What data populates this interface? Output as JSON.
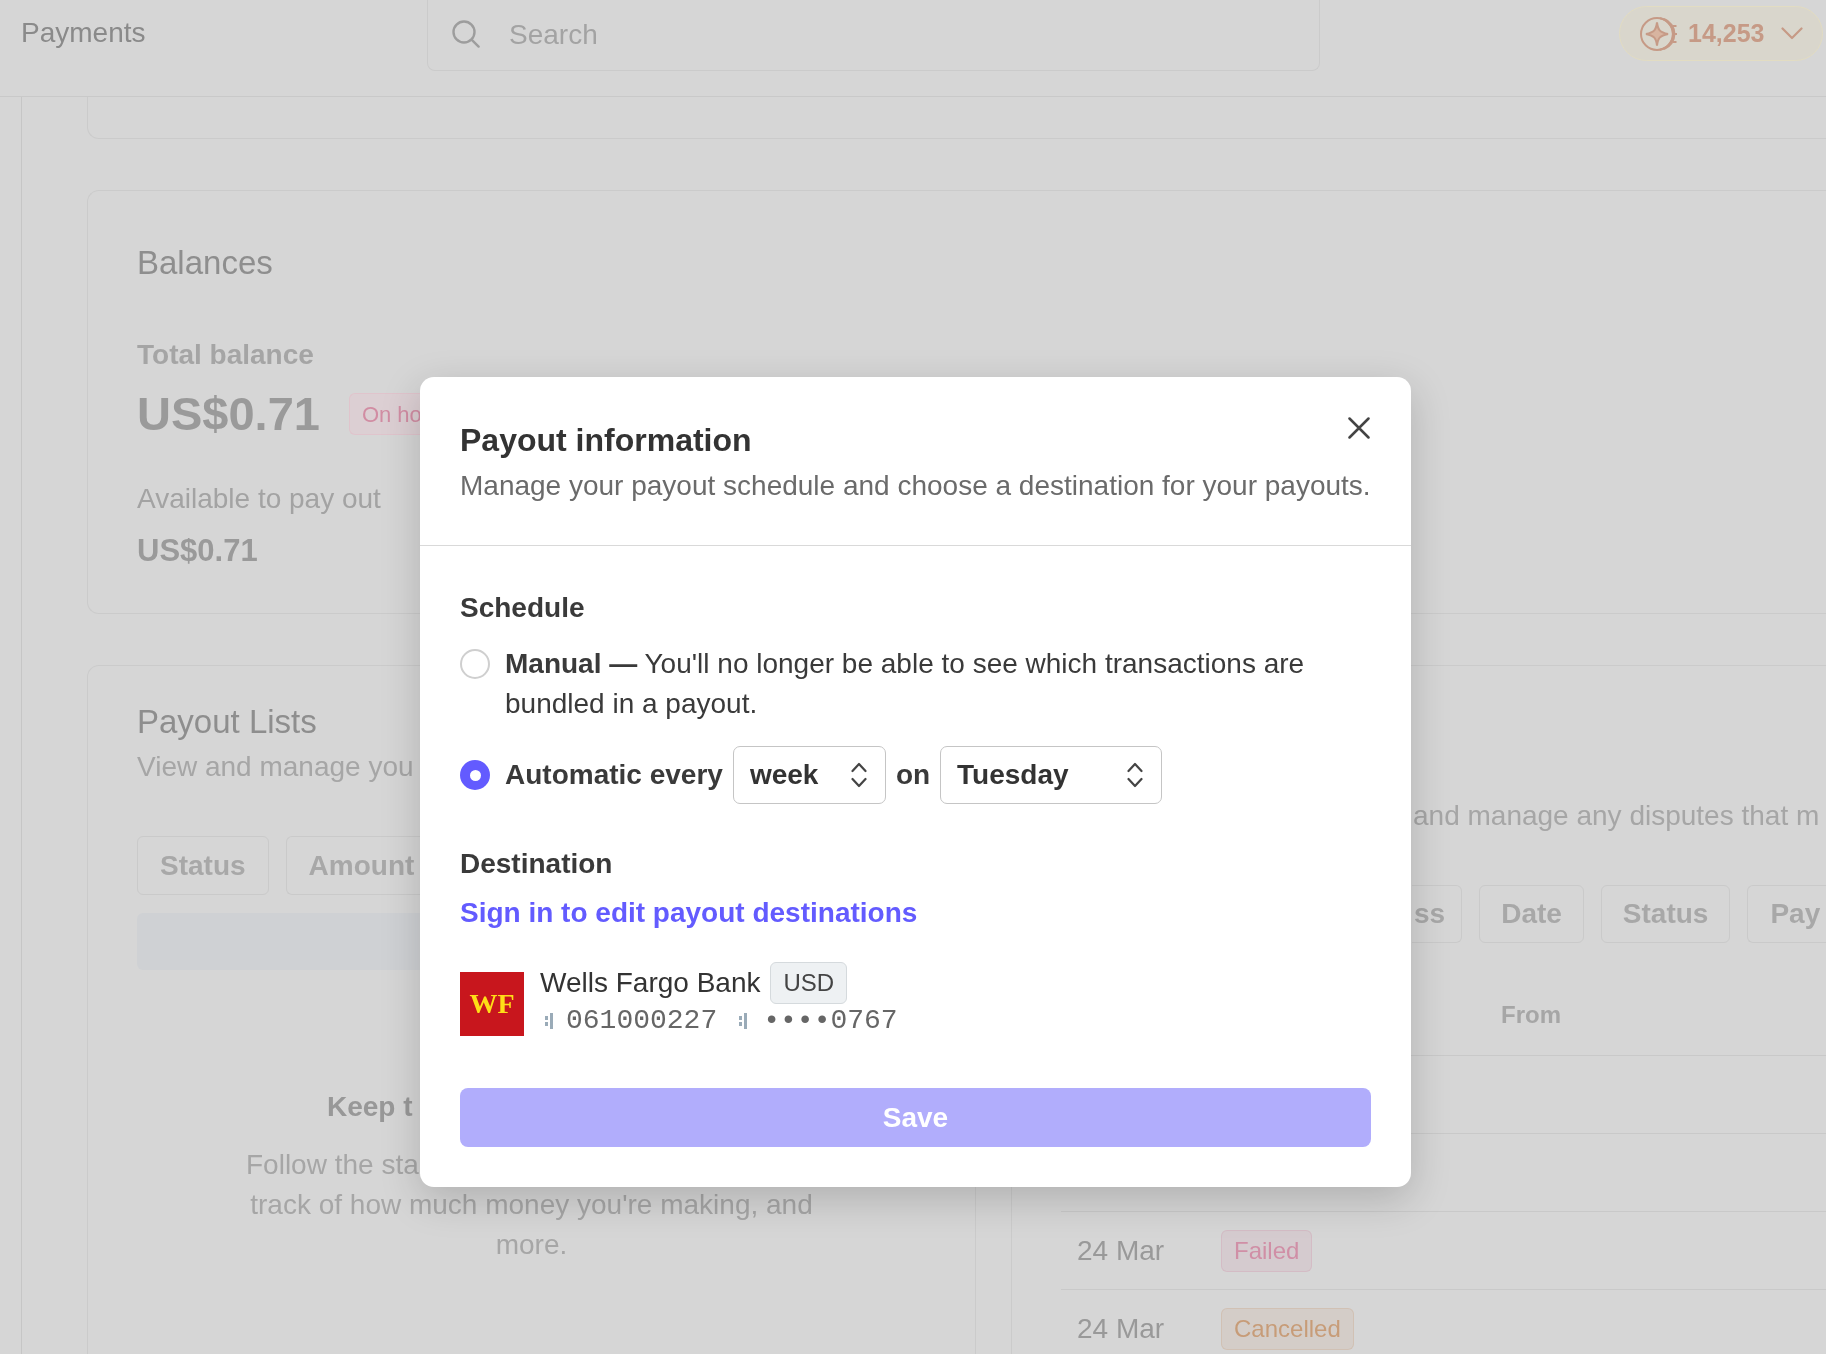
{
  "header": {
    "title": "Payments",
    "search": {
      "placeholder": "Search"
    },
    "points": "14,253"
  },
  "balances": {
    "title": "Balances",
    "total_label": "Total balance",
    "total_amount": "US$0.71",
    "total_status": "On ho",
    "available_label": "Available to pay out",
    "available_amount": "US$0.71"
  },
  "payout_lists": {
    "title": "Payout Lists",
    "subtitle": "View and manage you",
    "filters": [
      "Status",
      "Amount"
    ],
    "empty_state": {
      "title": "Keep t",
      "lines": [
        "Follow the sta",
        "track of how much money you're making, and",
        "more."
      ]
    }
  },
  "right_panel": {
    "subtitle": "and manage any disputes that m",
    "filters": [
      "ss",
      "Date",
      "Status",
      "Pay"
    ],
    "table": {
      "header": "From",
      "rows": [
        {
          "column_1": "24 Mar",
          "status": {
            "label": "Failed",
            "color": "#d08fa6"
          }
        },
        {
          "column_1": "24 Mar",
          "status": {
            "label": "Cancelled",
            "color": "#c79c78"
          }
        }
      ]
    }
  },
  "modal": {
    "title": "Payout information",
    "description": "Manage your payout schedule and choose a destination for your payouts.",
    "schedule": {
      "heading": "Schedule",
      "options": [
        {
          "kind": "manual",
          "selected": false,
          "text": "**Manual —** You'll no longer be able to see which transactions are bundled in a payout."
        },
        {
          "kind": "automatic",
          "selected": true,
          "label": "Automatic every",
          "interval": "week",
          "joiner": "on",
          "day": "Tuesday"
        }
      ]
    },
    "destination": {
      "heading": "Destination",
      "link": "Sign in to edit payout destinations",
      "account": {
        "logo": "WF",
        "bank": "Wells Fargo Bank",
        "currency": "USD",
        "routing_number": "061000227",
        "account_number": "••••0767"
      }
    },
    "save_button": {
      "label": "Save",
      "disabled": true
    }
  }
}
